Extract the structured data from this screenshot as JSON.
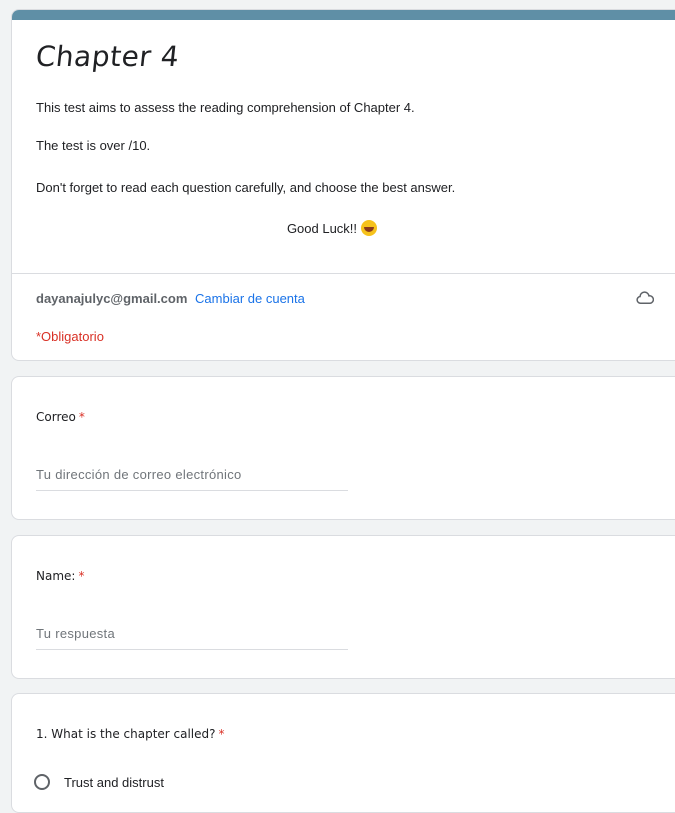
{
  "form": {
    "title": "Chapter 4",
    "description": [
      "This test aims to assess the reading comprehension of Chapter 4.",
      "The test is over /10.",
      "Don't forget to read each question carefully, and choose the best answer.",
      "Good Luck!!"
    ],
    "accent_color": "#5f8fa6"
  },
  "account": {
    "email": "dayanajulyc@gmail.com",
    "switch_label": "Cambiar de cuenta",
    "required_note": "*Obligatorio"
  },
  "questions": [
    {
      "label": "Correo",
      "required_mark": "*",
      "placeholder": "Tu dirección de correo electrónico"
    },
    {
      "label": "Name:",
      "required_mark": "*",
      "placeholder": "Tu respuesta"
    },
    {
      "label": "1. What is the chapter called?",
      "required_mark": "*",
      "options": [
        "Trust and distrust"
      ]
    }
  ]
}
